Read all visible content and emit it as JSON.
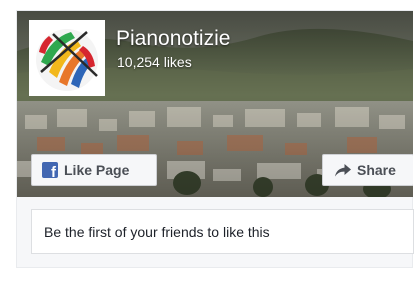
{
  "page": {
    "name": "Pianonotizie",
    "likes": "10,254 likes"
  },
  "buttons": {
    "like_label": "Like Page",
    "like_icon": "facebook-f-icon",
    "share_label": "Share",
    "share_icon": "share-arrow-icon"
  },
  "social_context": "Be the first of your friends to like this",
  "colors": {
    "facebook_blue": "#4267b2",
    "button_text": "#4b4f56",
    "panel_bg": "#f6f7f9"
  }
}
